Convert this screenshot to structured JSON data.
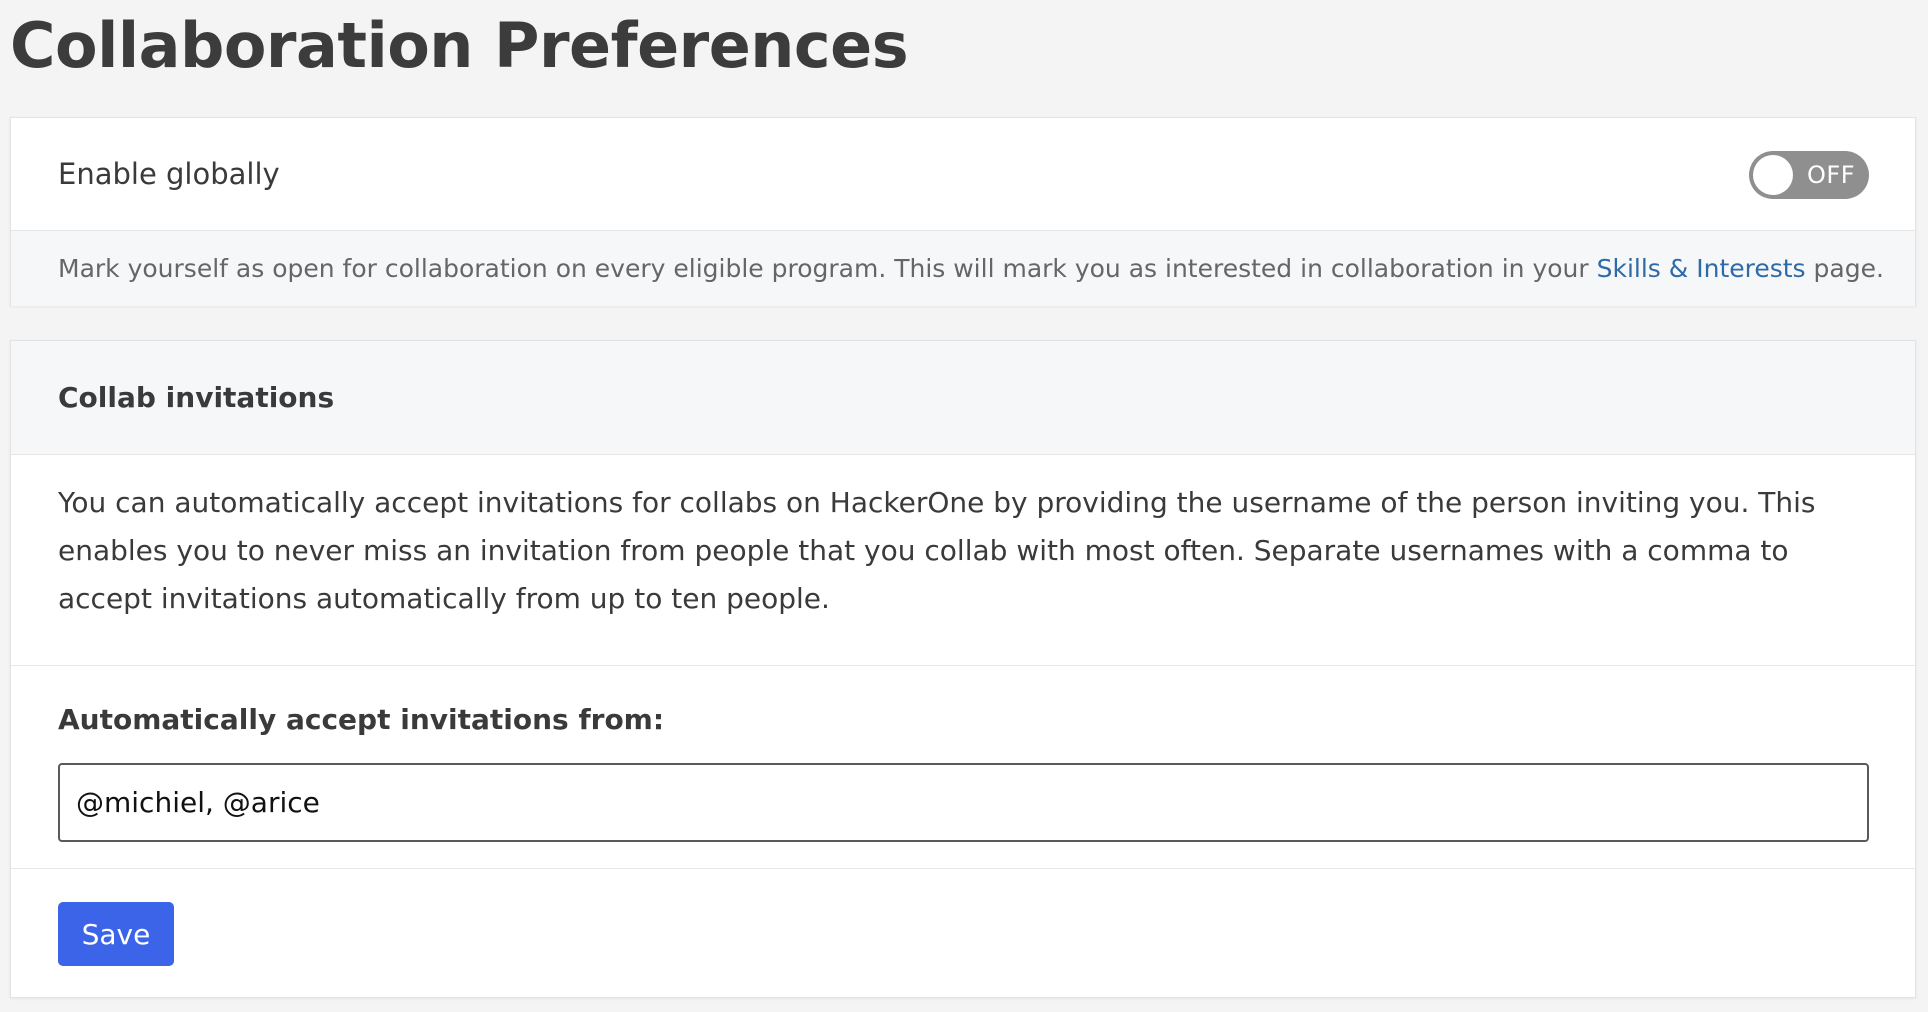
{
  "page": {
    "title": "Collaboration Preferences"
  },
  "global": {
    "label": "Enable globally",
    "toggle": {
      "state_label": "OFF",
      "enabled": false
    },
    "description_before": "Mark yourself as open for collaboration on every eligible program. This will mark you as interested in collaboration in your ",
    "link_text": "Skills & Interests",
    "description_after": " page."
  },
  "collab": {
    "title": "Collab invitations",
    "description": "You can automatically accept invitations for collabs on HackerOne by providing the username of the person inviting you. This enables you to never miss an invitation from people that you collab with most often. Separate usernames with a comma to accept invitations automatically from up to ten people.",
    "auto_accept_label": "Automatically accept invitations from:",
    "auto_accept_value": "@michiel, @arice",
    "save_label": "Save"
  },
  "colors": {
    "accent": "#3c64e8",
    "link": "#2e6aa8",
    "toggle_off": "#8f8f8f"
  }
}
